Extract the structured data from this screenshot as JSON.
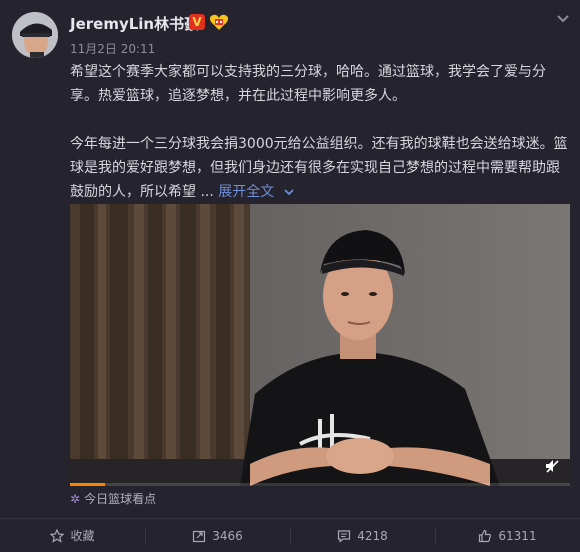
{
  "user": {
    "name": "JeremyLin林书豪",
    "verified_badge": "V",
    "timestamp": "11月2日 20:11"
  },
  "post": {
    "paragraph1": "希望这个赛季大家都可以支持我的三分球，哈哈。通过篮球，我学会了爱与分享。热爱篮球，追逐梦想，并在此过程中影响更多人。",
    "paragraph2": "今年每进一个三分球我会捐3000元给公益组织。还有我的球鞋也会送给球迷。篮球是我的爱好跟梦想，但我们身边还有很多在实现自己梦想的过程中需要帮助跟鼓励的人，所以希望",
    "ellipsis": " ... ",
    "expand_label": "展开全文",
    "expand_icon": "chevron-down-icon"
  },
  "video": {
    "progress": 0.07,
    "mute_icon": "speaker-muted-icon"
  },
  "topic": {
    "label": "今日篮球看点",
    "icon": "pinwheel-icon"
  },
  "actions": {
    "favorite": {
      "label": "收藏",
      "icon": "star-icon"
    },
    "repost": {
      "count": "3466",
      "icon": "repost-icon"
    },
    "comment": {
      "count": "4218",
      "icon": "comment-icon"
    },
    "like": {
      "count": "61311",
      "icon": "thumbs-up-icon"
    }
  },
  "colors": {
    "background": "#25232e",
    "link": "#6d8fd8",
    "verified": "#e0301e",
    "progress": "#ff8200"
  }
}
